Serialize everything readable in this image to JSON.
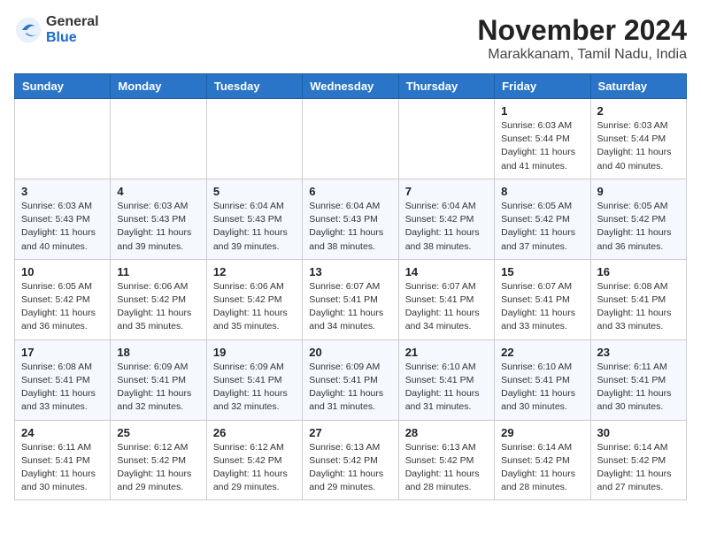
{
  "header": {
    "logo_general": "General",
    "logo_blue": "Blue",
    "month_title": "November 2024",
    "location": "Marakkanam, Tamil Nadu, India"
  },
  "weekdays": [
    "Sunday",
    "Monday",
    "Tuesday",
    "Wednesday",
    "Thursday",
    "Friday",
    "Saturday"
  ],
  "weeks": [
    [
      {
        "day": "",
        "info": ""
      },
      {
        "day": "",
        "info": ""
      },
      {
        "day": "",
        "info": ""
      },
      {
        "day": "",
        "info": ""
      },
      {
        "day": "",
        "info": ""
      },
      {
        "day": "1",
        "info": "Sunrise: 6:03 AM\nSunset: 5:44 PM\nDaylight: 11 hours\nand 41 minutes."
      },
      {
        "day": "2",
        "info": "Sunrise: 6:03 AM\nSunset: 5:44 PM\nDaylight: 11 hours\nand 40 minutes."
      }
    ],
    [
      {
        "day": "3",
        "info": "Sunrise: 6:03 AM\nSunset: 5:43 PM\nDaylight: 11 hours\nand 40 minutes."
      },
      {
        "day": "4",
        "info": "Sunrise: 6:03 AM\nSunset: 5:43 PM\nDaylight: 11 hours\nand 39 minutes."
      },
      {
        "day": "5",
        "info": "Sunrise: 6:04 AM\nSunset: 5:43 PM\nDaylight: 11 hours\nand 39 minutes."
      },
      {
        "day": "6",
        "info": "Sunrise: 6:04 AM\nSunset: 5:43 PM\nDaylight: 11 hours\nand 38 minutes."
      },
      {
        "day": "7",
        "info": "Sunrise: 6:04 AM\nSunset: 5:42 PM\nDaylight: 11 hours\nand 38 minutes."
      },
      {
        "day": "8",
        "info": "Sunrise: 6:05 AM\nSunset: 5:42 PM\nDaylight: 11 hours\nand 37 minutes."
      },
      {
        "day": "9",
        "info": "Sunrise: 6:05 AM\nSunset: 5:42 PM\nDaylight: 11 hours\nand 36 minutes."
      }
    ],
    [
      {
        "day": "10",
        "info": "Sunrise: 6:05 AM\nSunset: 5:42 PM\nDaylight: 11 hours\nand 36 minutes."
      },
      {
        "day": "11",
        "info": "Sunrise: 6:06 AM\nSunset: 5:42 PM\nDaylight: 11 hours\nand 35 minutes."
      },
      {
        "day": "12",
        "info": "Sunrise: 6:06 AM\nSunset: 5:42 PM\nDaylight: 11 hours\nand 35 minutes."
      },
      {
        "day": "13",
        "info": "Sunrise: 6:07 AM\nSunset: 5:41 PM\nDaylight: 11 hours\nand 34 minutes."
      },
      {
        "day": "14",
        "info": "Sunrise: 6:07 AM\nSunset: 5:41 PM\nDaylight: 11 hours\nand 34 minutes."
      },
      {
        "day": "15",
        "info": "Sunrise: 6:07 AM\nSunset: 5:41 PM\nDaylight: 11 hours\nand 33 minutes."
      },
      {
        "day": "16",
        "info": "Sunrise: 6:08 AM\nSunset: 5:41 PM\nDaylight: 11 hours\nand 33 minutes."
      }
    ],
    [
      {
        "day": "17",
        "info": "Sunrise: 6:08 AM\nSunset: 5:41 PM\nDaylight: 11 hours\nand 33 minutes."
      },
      {
        "day": "18",
        "info": "Sunrise: 6:09 AM\nSunset: 5:41 PM\nDaylight: 11 hours\nand 32 minutes."
      },
      {
        "day": "19",
        "info": "Sunrise: 6:09 AM\nSunset: 5:41 PM\nDaylight: 11 hours\nand 32 minutes."
      },
      {
        "day": "20",
        "info": "Sunrise: 6:09 AM\nSunset: 5:41 PM\nDaylight: 11 hours\nand 31 minutes."
      },
      {
        "day": "21",
        "info": "Sunrise: 6:10 AM\nSunset: 5:41 PM\nDaylight: 11 hours\nand 31 minutes."
      },
      {
        "day": "22",
        "info": "Sunrise: 6:10 AM\nSunset: 5:41 PM\nDaylight: 11 hours\nand 30 minutes."
      },
      {
        "day": "23",
        "info": "Sunrise: 6:11 AM\nSunset: 5:41 PM\nDaylight: 11 hours\nand 30 minutes."
      }
    ],
    [
      {
        "day": "24",
        "info": "Sunrise: 6:11 AM\nSunset: 5:41 PM\nDaylight: 11 hours\nand 30 minutes."
      },
      {
        "day": "25",
        "info": "Sunrise: 6:12 AM\nSunset: 5:42 PM\nDaylight: 11 hours\nand 29 minutes."
      },
      {
        "day": "26",
        "info": "Sunrise: 6:12 AM\nSunset: 5:42 PM\nDaylight: 11 hours\nand 29 minutes."
      },
      {
        "day": "27",
        "info": "Sunrise: 6:13 AM\nSunset: 5:42 PM\nDaylight: 11 hours\nand 29 minutes."
      },
      {
        "day": "28",
        "info": "Sunrise: 6:13 AM\nSunset: 5:42 PM\nDaylight: 11 hours\nand 28 minutes."
      },
      {
        "day": "29",
        "info": "Sunrise: 6:14 AM\nSunset: 5:42 PM\nDaylight: 11 hours\nand 28 minutes."
      },
      {
        "day": "30",
        "info": "Sunrise: 6:14 AM\nSunset: 5:42 PM\nDaylight: 11 hours\nand 27 minutes."
      }
    ]
  ]
}
